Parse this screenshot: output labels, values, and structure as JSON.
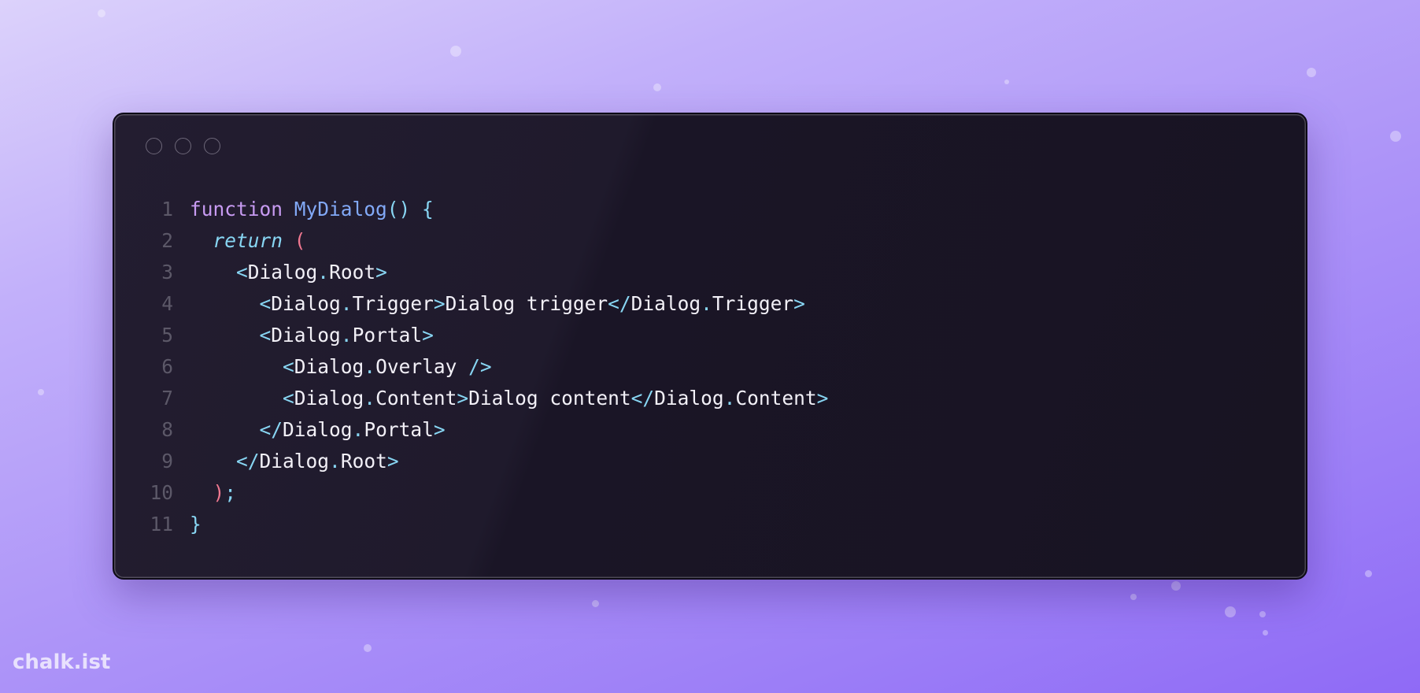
{
  "window": {
    "controls": [
      "window-dot",
      "window-dot",
      "window-dot"
    ]
  },
  "code": {
    "language": "jsx",
    "lines": [
      {
        "n": "1",
        "tokens": [
          {
            "t": "function",
            "c": "kw"
          },
          {
            "t": " ",
            "c": "plain"
          },
          {
            "t": "MyDialog",
            "c": "fn"
          },
          {
            "t": "() {",
            "c": "punc"
          }
        ]
      },
      {
        "n": "2",
        "tokens": [
          {
            "t": "  ",
            "c": "plain"
          },
          {
            "t": "return",
            "c": "ret"
          },
          {
            "t": " ",
            "c": "plain"
          },
          {
            "t": "(",
            "c": "paren"
          }
        ]
      },
      {
        "n": "3",
        "tokens": [
          {
            "t": "    ",
            "c": "plain"
          },
          {
            "t": "<",
            "c": "punc"
          },
          {
            "t": "Dialog",
            "c": "tag"
          },
          {
            "t": ".",
            "c": "punc"
          },
          {
            "t": "Root",
            "c": "tag"
          },
          {
            "t": ">",
            "c": "punc"
          }
        ]
      },
      {
        "n": "4",
        "tokens": [
          {
            "t": "      ",
            "c": "plain"
          },
          {
            "t": "<",
            "c": "punc"
          },
          {
            "t": "Dialog",
            "c": "tag"
          },
          {
            "t": ".",
            "c": "punc"
          },
          {
            "t": "Trigger",
            "c": "tag"
          },
          {
            "t": ">",
            "c": "punc"
          },
          {
            "t": "Dialog trigger",
            "c": "plain"
          },
          {
            "t": "</",
            "c": "punc"
          },
          {
            "t": "Dialog",
            "c": "tag"
          },
          {
            "t": ".",
            "c": "punc"
          },
          {
            "t": "Trigger",
            "c": "tag"
          },
          {
            "t": ">",
            "c": "punc"
          }
        ]
      },
      {
        "n": "5",
        "tokens": [
          {
            "t": "      ",
            "c": "plain"
          },
          {
            "t": "<",
            "c": "punc"
          },
          {
            "t": "Dialog",
            "c": "tag"
          },
          {
            "t": ".",
            "c": "punc"
          },
          {
            "t": "Portal",
            "c": "tag"
          },
          {
            "t": ">",
            "c": "punc"
          }
        ]
      },
      {
        "n": "6",
        "tokens": [
          {
            "t": "        ",
            "c": "plain"
          },
          {
            "t": "<",
            "c": "punc"
          },
          {
            "t": "Dialog",
            "c": "tag"
          },
          {
            "t": ".",
            "c": "punc"
          },
          {
            "t": "Overlay",
            "c": "tag"
          },
          {
            "t": " ",
            "c": "plain"
          },
          {
            "t": "/>",
            "c": "punc"
          }
        ]
      },
      {
        "n": "7",
        "tokens": [
          {
            "t": "        ",
            "c": "plain"
          },
          {
            "t": "<",
            "c": "punc"
          },
          {
            "t": "Dialog",
            "c": "tag"
          },
          {
            "t": ".",
            "c": "punc"
          },
          {
            "t": "Content",
            "c": "tag"
          },
          {
            "t": ">",
            "c": "punc"
          },
          {
            "t": "Dialog content",
            "c": "plain"
          },
          {
            "t": "</",
            "c": "punc"
          },
          {
            "t": "Dialog",
            "c": "tag"
          },
          {
            "t": ".",
            "c": "punc"
          },
          {
            "t": "Content",
            "c": "tag"
          },
          {
            "t": ">",
            "c": "punc"
          }
        ]
      },
      {
        "n": "8",
        "tokens": [
          {
            "t": "      ",
            "c": "plain"
          },
          {
            "t": "</",
            "c": "punc"
          },
          {
            "t": "Dialog",
            "c": "tag"
          },
          {
            "t": ".",
            "c": "punc"
          },
          {
            "t": "Portal",
            "c": "tag"
          },
          {
            "t": ">",
            "c": "punc"
          }
        ]
      },
      {
        "n": "9",
        "tokens": [
          {
            "t": "    ",
            "c": "plain"
          },
          {
            "t": "</",
            "c": "punc"
          },
          {
            "t": "Dialog",
            "c": "tag"
          },
          {
            "t": ".",
            "c": "punc"
          },
          {
            "t": "Root",
            "c": "tag"
          },
          {
            "t": ">",
            "c": "punc"
          }
        ]
      },
      {
        "n": "10",
        "tokens": [
          {
            "t": "  ",
            "c": "plain"
          },
          {
            "t": ")",
            "c": "paren"
          },
          {
            "t": ";",
            "c": "punc"
          }
        ]
      },
      {
        "n": "11",
        "tokens": [
          {
            "t": "}",
            "c": "punc"
          }
        ]
      }
    ]
  },
  "watermark": "chalk.ist",
  "colors": {
    "keyword": "#c89bf2",
    "function": "#82a9f7",
    "punctuation": "#88d6f3",
    "paren": "#f07890",
    "text": "#f2f0f7",
    "line_number": "#5c5868",
    "window_bg": "#1c1727"
  }
}
